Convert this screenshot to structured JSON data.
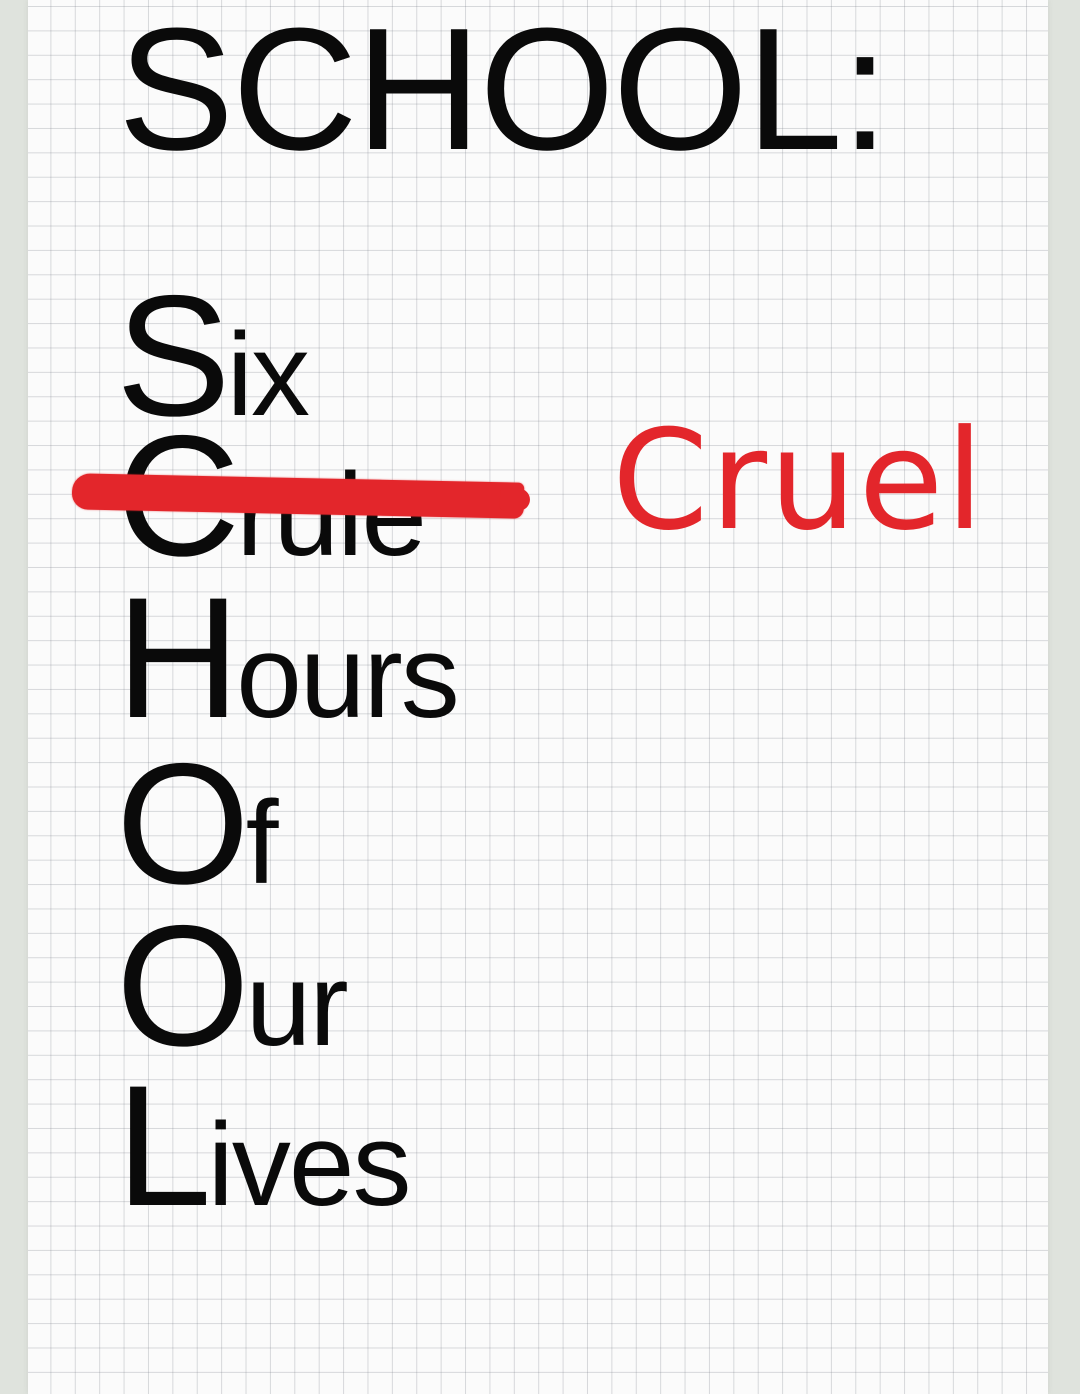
{
  "title": "SCHOOL:",
  "acronym": [
    {
      "letter": "S",
      "rest": "ix"
    },
    {
      "letter": "C",
      "rest": "rule",
      "struck": true
    },
    {
      "letter": "H",
      "rest": "ours"
    },
    {
      "letter": "O",
      "rest": "f"
    },
    {
      "letter": "O",
      "rest": "ur"
    },
    {
      "letter": "L",
      "rest": "ives"
    }
  ],
  "correction": "Cruel",
  "colors": {
    "ink": "#0a0a0a",
    "correction_red": "#e3262b",
    "paper": "#fbfbfb",
    "grid": "#9aa0aa"
  }
}
